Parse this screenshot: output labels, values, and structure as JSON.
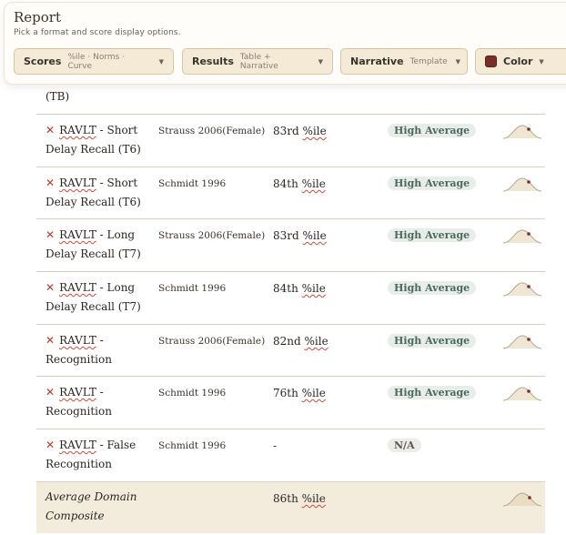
{
  "panel": {
    "title": "Report",
    "subtitle": "Pick a format and score display options.",
    "pills": {
      "scores": {
        "label": "Scores",
        "value": "%ile · Norms · Curve"
      },
      "results": {
        "label": "Results",
        "value": "Table + Narrative"
      },
      "narrative": {
        "label": "Narrative",
        "value": "Template"
      },
      "color": {
        "label": "Color",
        "swatch": "#7a2e2a"
      }
    }
  },
  "table": {
    "partial_row": {
      "name_tail": "(TB)"
    },
    "rows": [
      {
        "name_line1": "RAVLT",
        "name_rest1": " - Short",
        "name_line2": "Delay Recall (T6)",
        "norm": "Strauss 2006(Female)",
        "score_num": "83rd ",
        "score_unit": "%ile",
        "classification": "High Average"
      },
      {
        "name_line1": "RAVLT",
        "name_rest1": " - Short",
        "name_line2": "Delay Recall (T6)",
        "norm": "Schmidt 1996",
        "score_num": "84th ",
        "score_unit": "%ile",
        "classification": "High Average"
      },
      {
        "name_line1": "RAVLT",
        "name_rest1": " - Long",
        "name_line2": "Delay Recall (T7)",
        "norm": "Strauss 2006(Female)",
        "score_num": "83rd ",
        "score_unit": "%ile",
        "classification": "High Average"
      },
      {
        "name_line1": "RAVLT",
        "name_rest1": " - Long",
        "name_line2": "Delay Recall (T7)",
        "norm": "Schmidt 1996",
        "score_num": "84th ",
        "score_unit": "%ile",
        "classification": "High Average"
      },
      {
        "name_line1": "RAVLT",
        "name_rest1": " -",
        "name_line2": "Recognition",
        "norm": "Strauss 2006(Female)",
        "score_num": "82nd ",
        "score_unit": "%ile",
        "classification": "High Average"
      },
      {
        "name_line1": "RAVLT",
        "name_rest1": " -",
        "name_line2": "Recognition",
        "norm": "Schmidt 1996",
        "score_num": "76th ",
        "score_unit": "%ile",
        "classification": "High Average"
      },
      {
        "name_line1": "RAVLT",
        "name_rest1": " - False",
        "name_line2": "Recognition",
        "norm": "Schmidt 1996",
        "score_num": "-",
        "score_unit": "",
        "classification": "N/A"
      }
    ],
    "composite": {
      "name_line1": "Average Domain",
      "name_line2": "Composite",
      "score_num": "86th ",
      "score_unit": "%ile"
    }
  },
  "colors": {
    "accent": "#7a2e2a",
    "badge_high_avg_bg": "#e8ede9",
    "badge_high_avg_fg": "#4a6a5e",
    "remove_icon": "#c0392b"
  }
}
